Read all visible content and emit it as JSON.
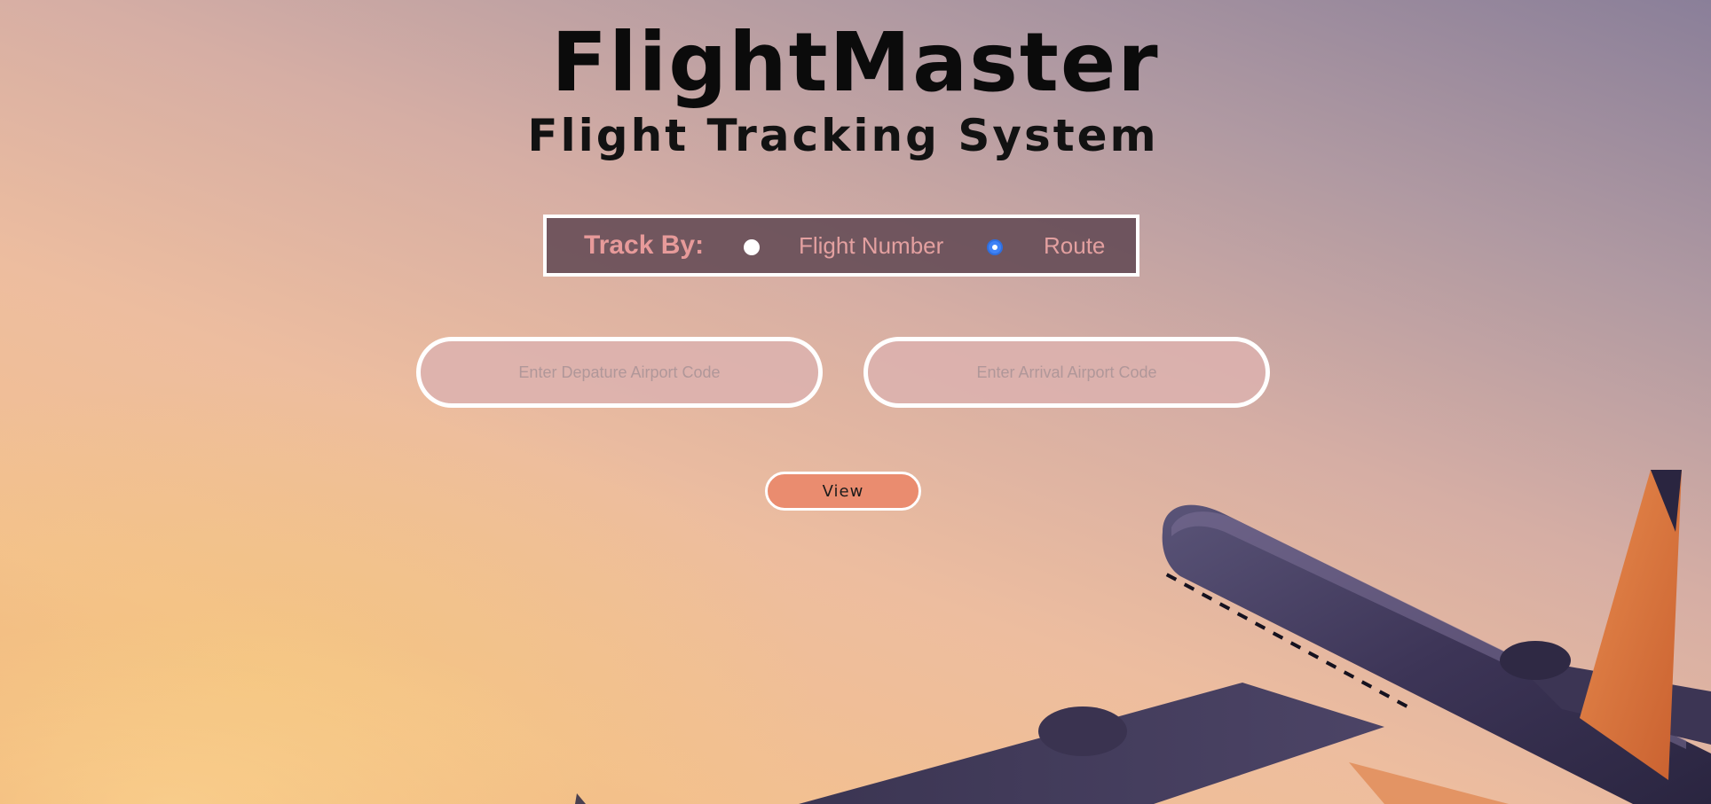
{
  "header": {
    "title": "FlightMaster",
    "subtitle": "Flight Tracking System"
  },
  "track_by": {
    "label": "Track By:",
    "options": [
      {
        "label": "Flight Number",
        "selected": false
      },
      {
        "label": "Route",
        "selected": true
      }
    ]
  },
  "route_form": {
    "departure_placeholder": "Enter Depature Airport Code",
    "departure_value": "",
    "arrival_placeholder": "Enter Arrival Airport Code",
    "arrival_value": "",
    "view_label": "View"
  },
  "colors": {
    "accent_button": "#ea8c6f",
    "radio_selected": "#3f82f6",
    "trackby_text": "#e79a9a"
  }
}
